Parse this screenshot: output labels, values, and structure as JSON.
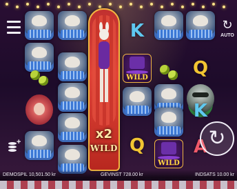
{
  "game": {
    "wild_label": "WILD",
    "multiplier": "x2",
    "wild_reel_label": "WILD"
  },
  "symbols": {
    "reel1": [
      "monkey",
      "monkey",
      "maraca",
      "lion",
      "monkey"
    ],
    "reel2": [
      "monkey",
      "monkey",
      "monkey",
      "monkey",
      "monkey"
    ],
    "reel4": [
      "K",
      "hat-wild",
      "monkey",
      "Q",
      ""
    ],
    "reel5": [
      "monkey",
      "maraca",
      "monkey",
      "monkey",
      "hat-wild"
    ],
    "reel6": [
      "monkey",
      "Q",
      "raccoon",
      "K",
      "A"
    ]
  },
  "controls": {
    "auto_label": "AUTO"
  },
  "footer": {
    "balance": "DEMOSPIL 10,501.50 kr",
    "win": "GEVINST 728.00 kr",
    "bet": "INDSATS 10.00 kr"
  }
}
